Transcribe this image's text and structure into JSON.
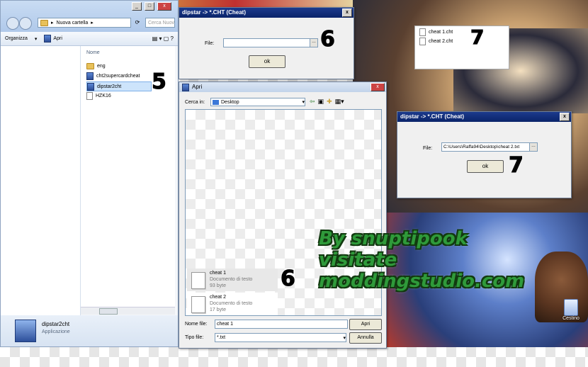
{
  "explorer": {
    "address_crumb": "Nuova cartella",
    "search_placeholder": "Cerca Nuov",
    "organize": "Organizza",
    "open": "Apri",
    "column_name": "Nome",
    "files": [
      "eng",
      "cht2supercardcheat",
      "dipstar2cht",
      "HZK16"
    ],
    "detail_name": "dipstar2cht",
    "detail_type": "Applicazione"
  },
  "dlg_top": {
    "title": "dipstar -> *.CHT (Cheat)",
    "file_label": "File:",
    "file_value": "",
    "ok": "ok"
  },
  "dlg_right": {
    "title": "dipstar -> *.CHT (Cheat)",
    "file_label": "File:",
    "file_value": "C:\\Users\\Raffa94\\Desktop\\cheat 2.txt",
    "ok": "ok"
  },
  "cht_list": [
    "cheat 1.cht",
    "cheat 2.cht"
  ],
  "open_dialog": {
    "title": "Apri",
    "look_in_label": "Cerca in:",
    "look_in_value": "Desktop",
    "items": [
      {
        "name": "cheat 1",
        "type": "Documento di testo",
        "size": "93 byte"
      },
      {
        "name": "cheat 2",
        "type": "Documento di testo",
        "size": "17 byte"
      }
    ],
    "filename_label": "Nome file:",
    "filename_value": "cheat 1",
    "filetype_label": "Tipo file:",
    "filetype_value": "*.txt",
    "open_btn": "Apri",
    "cancel_btn": "Annulla"
  },
  "steps": {
    "s5": "5",
    "s6a": "6",
    "s6b": "6",
    "s7a": "7",
    "s7b": "7"
  },
  "watermark": [
    "By snuptipook",
    "visitate",
    "moddingstudio.com"
  ],
  "desktop_icon": "Cestino"
}
